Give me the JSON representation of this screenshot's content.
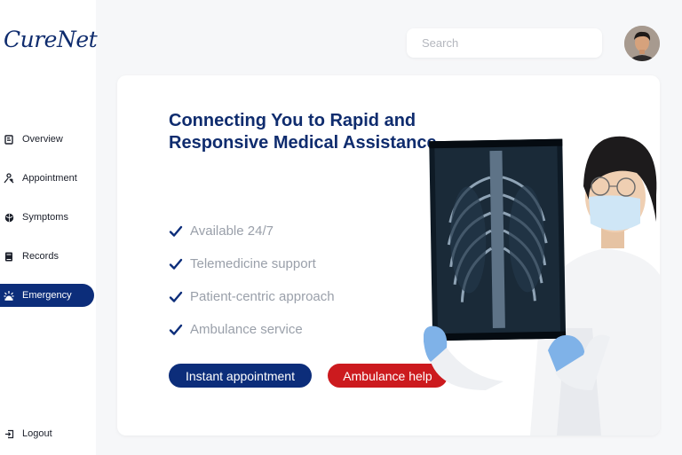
{
  "app": {
    "logo_text": "CureNet"
  },
  "sidebar": {
    "items": [
      {
        "label": "Overview",
        "icon": "overview-icon"
      },
      {
        "label": "Appointment",
        "icon": "appointment-icon"
      },
      {
        "label": "Symptoms",
        "icon": "symptoms-icon"
      },
      {
        "label": "Records",
        "icon": "records-icon"
      },
      {
        "label": "Emergency",
        "icon": "emergency-icon",
        "active": true
      }
    ],
    "logout_label": "Logout"
  },
  "topbar": {
    "search_placeholder": "Search"
  },
  "hero": {
    "headline": "Connecting You to Rapid and Responsive Medical Assistance",
    "features": [
      "Available 24/7",
      "Telemedicine support",
      "Patient-centric approach",
      "Ambulance service"
    ],
    "primary_button": "Instant appointment",
    "secondary_button": "Ambulance help"
  },
  "colors": {
    "brand": "#0c2d7a",
    "danger": "#cc1a1e",
    "muted_text": "#9aa0aa"
  }
}
